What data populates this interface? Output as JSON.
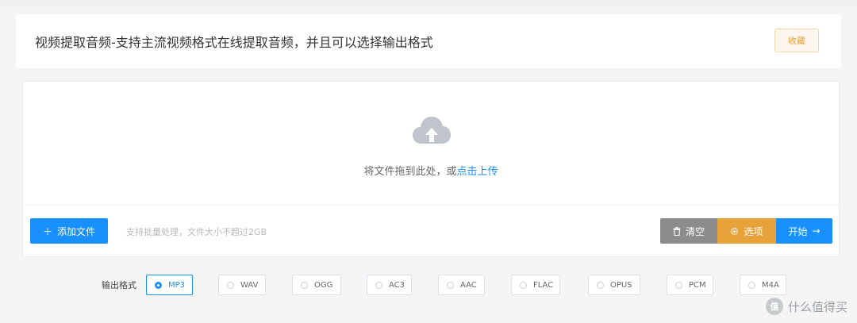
{
  "header": {
    "title": "视频提取音频-支持主流视频格式在线提取音频，并且可以选择输出格式",
    "favorite_label": "收藏"
  },
  "upload": {
    "prompt_prefix": "将文件拖到此处，或",
    "prompt_link": "点击上传",
    "add_button_label": "添加文件",
    "hint": "支持批量处理，文件大小不超过2GB",
    "clear_label": "清空",
    "options_label": "选项",
    "start_label": "开始"
  },
  "formats": {
    "label": "输出格式",
    "selected": "MP3",
    "items": [
      "MP3",
      "WAV",
      "OGG",
      "AC3",
      "AAC",
      "FLAC",
      "OPUS",
      "PCM",
      "M4A"
    ]
  },
  "watermark": {
    "logo": "值",
    "text": "什么值得买"
  },
  "colors": {
    "primary": "#1890ff",
    "warning": "#e8a23a",
    "neutral": "#8c8c8c"
  }
}
